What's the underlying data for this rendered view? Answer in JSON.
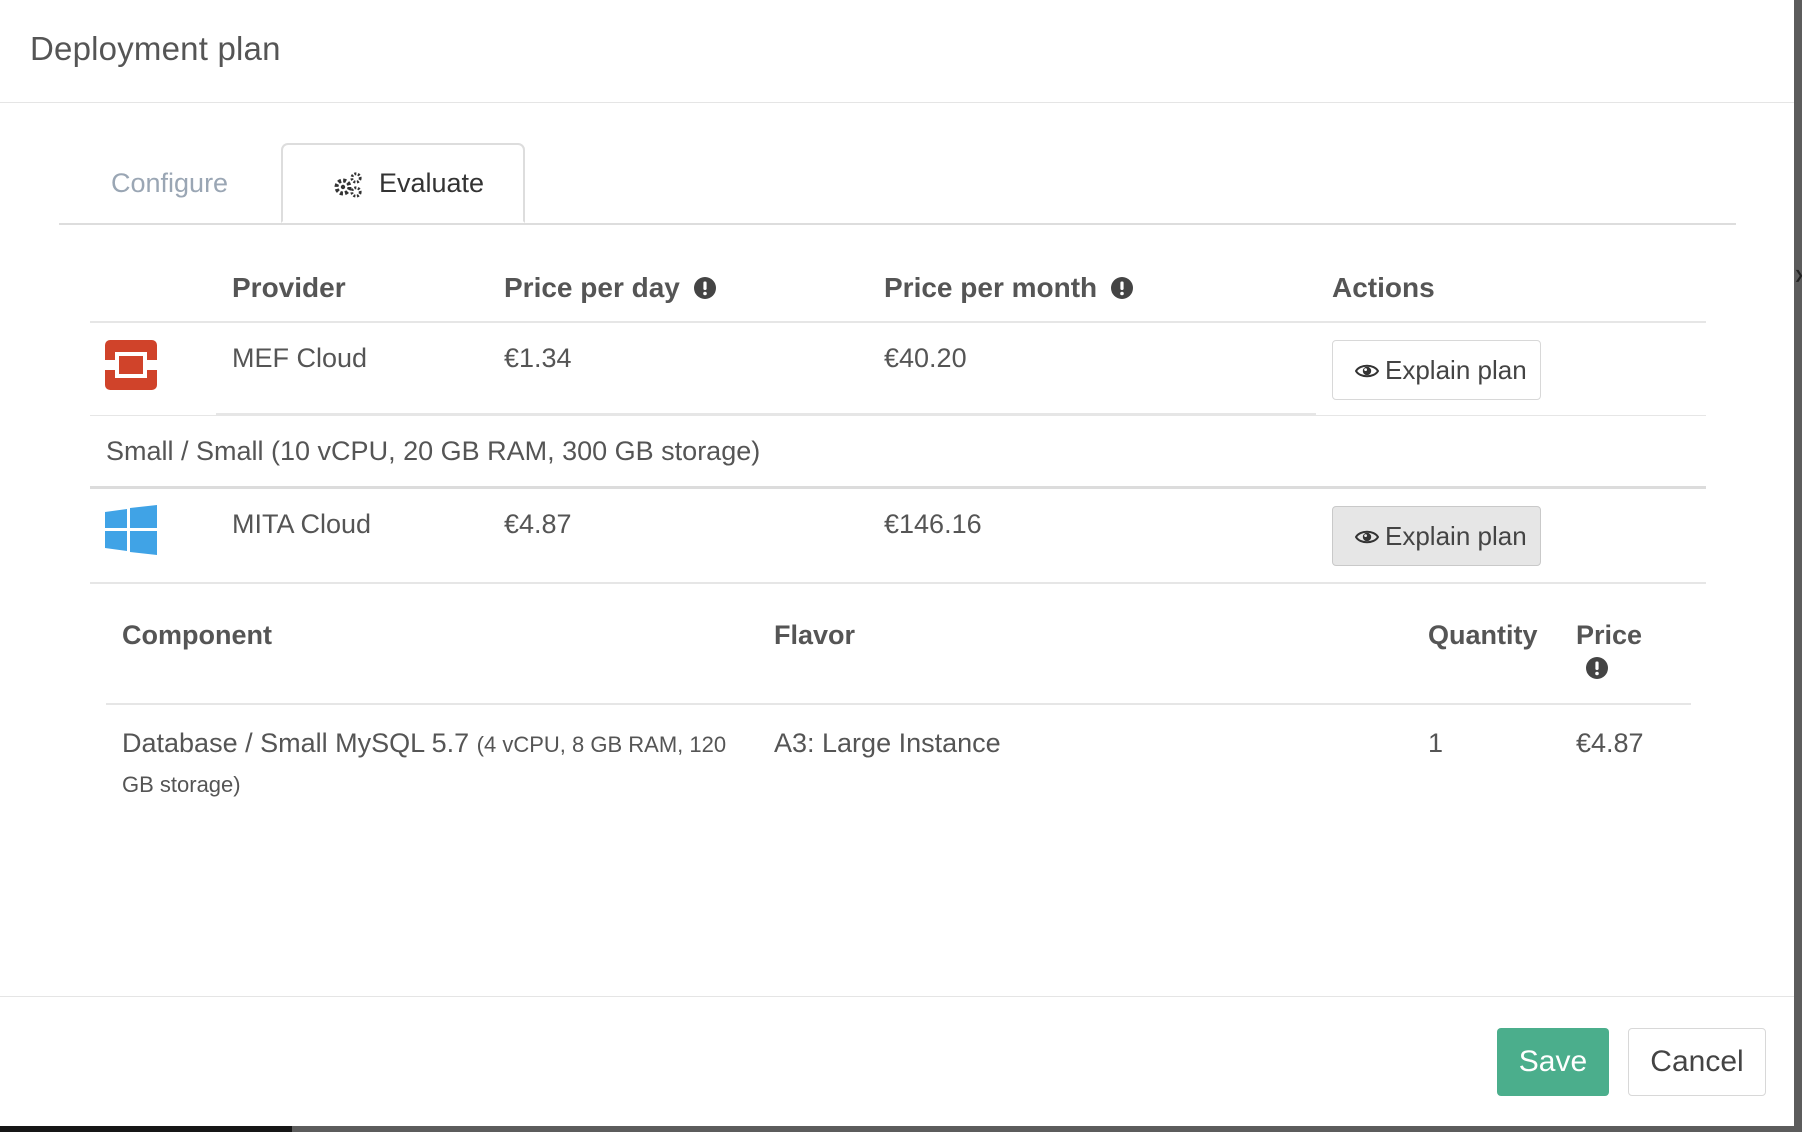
{
  "modal": {
    "title": "Deployment plan",
    "tabs": [
      {
        "label": "Configure",
        "active": false
      },
      {
        "label": "Evaluate",
        "active": true,
        "icon": "gears-icon"
      }
    ]
  },
  "providers_table": {
    "headers": {
      "provider": "Provider",
      "price_per_day": "Price per day",
      "price_per_month": "Price per month",
      "actions": "Actions"
    },
    "rows": [
      {
        "icon": "openstack-logo-icon",
        "icon_color": "#d0432a",
        "provider": "MEF Cloud",
        "price_per_day": "€1.34",
        "price_per_month": "€40.20",
        "action_label": "Explain plan",
        "expanded": false,
        "detail": "Small / Small (10 vCPU, 20 GB RAM, 300 GB storage)"
      },
      {
        "icon": "windows-logo-icon",
        "icon_color": "#40a3e6",
        "provider": "MITA Cloud",
        "price_per_day": "€4.87",
        "price_per_month": "€146.16",
        "action_label": "Explain plan",
        "expanded": true
      }
    ]
  },
  "plan_details": {
    "headers": {
      "component": "Component",
      "flavor": "Flavor",
      "quantity": "Quantity",
      "price": "Price"
    },
    "rows": [
      {
        "component": "Database / Small MySQL 5.7",
        "component_detail_line1": "(4 vCPU, 8 GB RAM, 120",
        "component_detail_line2": "GB storage)",
        "flavor": "A3: Large Instance",
        "quantity": "1",
        "price": "€4.87"
      }
    ]
  },
  "footer": {
    "save_label": "Save",
    "cancel_label": "Cancel",
    "save_color": "#4bae8c"
  }
}
